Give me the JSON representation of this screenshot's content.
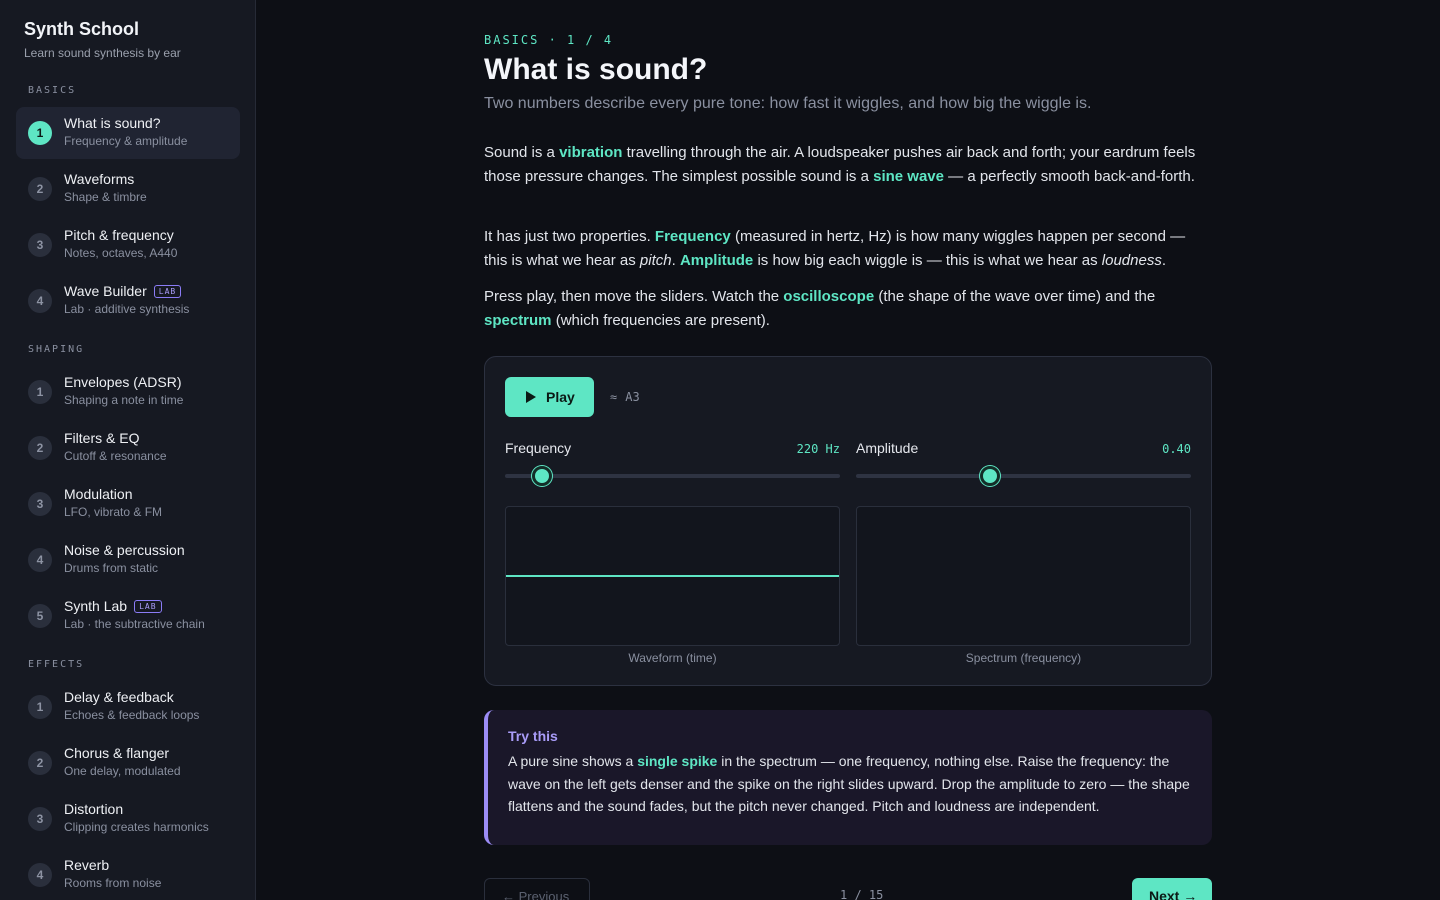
{
  "app": {
    "title": "Synth School",
    "subtitle": "Learn sound synthesis by ear"
  },
  "sidebar": {
    "sections": [
      {
        "label": "BASICS",
        "items": [
          {
            "num": "1",
            "title": "What is sound?",
            "sub": "Frequency & amplitude",
            "active": true
          },
          {
            "num": "2",
            "title": "Waveforms",
            "sub": "Shape & timbre"
          },
          {
            "num": "3",
            "title": "Pitch & frequency",
            "sub": "Notes, octaves, A440"
          },
          {
            "num": "4",
            "title": "Wave Builder",
            "badge": "LAB",
            "sub": "Lab · additive synthesis"
          }
        ]
      },
      {
        "label": "SHAPING",
        "items": [
          {
            "num": "1",
            "title": "Envelopes (ADSR)",
            "sub": "Shaping a note in time"
          },
          {
            "num": "2",
            "title": "Filters & EQ",
            "sub": "Cutoff & resonance"
          },
          {
            "num": "3",
            "title": "Modulation",
            "sub": "LFO, vibrato & FM"
          },
          {
            "num": "4",
            "title": "Noise & percussion",
            "sub": "Drums from static"
          },
          {
            "num": "5",
            "title": "Synth Lab",
            "badge": "LAB",
            "sub": "Lab · the subtractive chain"
          }
        ]
      },
      {
        "label": "EFFECTS",
        "items": [
          {
            "num": "1",
            "title": "Delay & feedback",
            "sub": "Echoes & feedback loops"
          },
          {
            "num": "2",
            "title": "Chorus & flanger",
            "sub": "One delay, modulated"
          },
          {
            "num": "3",
            "title": "Distortion",
            "sub": "Clipping creates harmonics"
          },
          {
            "num": "4",
            "title": "Reverb",
            "sub": "Rooms from noise"
          }
        ]
      }
    ]
  },
  "lesson": {
    "eyebrow": "BASICS · 1 / 4",
    "title": "What is sound?",
    "subtitle": "Two numbers describe every pure tone: how fast it wiggles, and how big the wiggle is.",
    "p1": {
      "a": "Sound is a ",
      "hl1": "vibration",
      "b": " travelling through the air. A loudspeaker pushes air back and forth; your eardrum feels those pressure changes. The simplest possible sound is a ",
      "hl2": "sine wave",
      "c": " — a perfectly smooth back-and-forth."
    },
    "p2": {
      "a": "It has just two properties. ",
      "hl1": "Frequency",
      "b": " (measured in hertz, Hz) is how many wiggles happen per second — this is what we hear as ",
      "em1": "pitch",
      "c": ". ",
      "hl2": "Amplitude",
      "d": " is how big each wiggle is — this is what we hear as ",
      "em2": "loudness",
      "e": "."
    },
    "p3": {
      "a": "Press play, then move the sliders. Watch the ",
      "hl1": "oscilloscope",
      "b": " (the shape of the wave over time) and the ",
      "hl2": "spectrum",
      "c": " (which frequencies are present)."
    }
  },
  "lab": {
    "play_label": "Play",
    "note_symbol": "≈",
    "note": "A3",
    "frequency": {
      "label": "Frequency",
      "value_text": "220 Hz",
      "level": 0.11
    },
    "amplitude": {
      "label": "Amplitude",
      "value_text": "0.40",
      "level": 0.4
    },
    "waveform_caption": "Waveform (time)",
    "spectrum_caption": "Spectrum (frequency)",
    "accent": "#5ee6c4"
  },
  "tip": {
    "title": "Try this",
    "a": "A pure sine shows a ",
    "hl": "single spike",
    "b": " in the spectrum — one frequency, nothing else. Raise the frequency: the wave on the left gets denser and the spike on the right slides upward. Drop the amplitude to zero — the shape flattens and the sound fades, but the pitch never changed. Pitch and loudness are independent."
  },
  "pager": {
    "prev_label": "← Previous",
    "count": "1 / 15",
    "next_label": "Next →"
  }
}
